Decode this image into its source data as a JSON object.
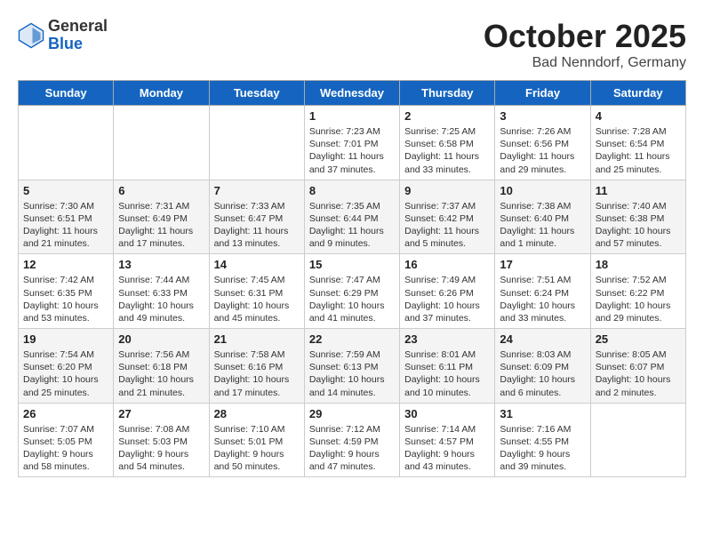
{
  "header": {
    "logo_general": "General",
    "logo_blue": "Blue",
    "month": "October 2025",
    "location": "Bad Nenndorf, Germany"
  },
  "days_of_week": [
    "Sunday",
    "Monday",
    "Tuesday",
    "Wednesday",
    "Thursday",
    "Friday",
    "Saturday"
  ],
  "weeks": [
    [
      {
        "day": "",
        "info": ""
      },
      {
        "day": "",
        "info": ""
      },
      {
        "day": "",
        "info": ""
      },
      {
        "day": "1",
        "info": "Sunrise: 7:23 AM\nSunset: 7:01 PM\nDaylight: 11 hours and 37 minutes."
      },
      {
        "day": "2",
        "info": "Sunrise: 7:25 AM\nSunset: 6:58 PM\nDaylight: 11 hours and 33 minutes."
      },
      {
        "day": "3",
        "info": "Sunrise: 7:26 AM\nSunset: 6:56 PM\nDaylight: 11 hours and 29 minutes."
      },
      {
        "day": "4",
        "info": "Sunrise: 7:28 AM\nSunset: 6:54 PM\nDaylight: 11 hours and 25 minutes."
      }
    ],
    [
      {
        "day": "5",
        "info": "Sunrise: 7:30 AM\nSunset: 6:51 PM\nDaylight: 11 hours and 21 minutes."
      },
      {
        "day": "6",
        "info": "Sunrise: 7:31 AM\nSunset: 6:49 PM\nDaylight: 11 hours and 17 minutes."
      },
      {
        "day": "7",
        "info": "Sunrise: 7:33 AM\nSunset: 6:47 PM\nDaylight: 11 hours and 13 minutes."
      },
      {
        "day": "8",
        "info": "Sunrise: 7:35 AM\nSunset: 6:44 PM\nDaylight: 11 hours and 9 minutes."
      },
      {
        "day": "9",
        "info": "Sunrise: 7:37 AM\nSunset: 6:42 PM\nDaylight: 11 hours and 5 minutes."
      },
      {
        "day": "10",
        "info": "Sunrise: 7:38 AM\nSunset: 6:40 PM\nDaylight: 11 hours and 1 minute."
      },
      {
        "day": "11",
        "info": "Sunrise: 7:40 AM\nSunset: 6:38 PM\nDaylight: 10 hours and 57 minutes."
      }
    ],
    [
      {
        "day": "12",
        "info": "Sunrise: 7:42 AM\nSunset: 6:35 PM\nDaylight: 10 hours and 53 minutes."
      },
      {
        "day": "13",
        "info": "Sunrise: 7:44 AM\nSunset: 6:33 PM\nDaylight: 10 hours and 49 minutes."
      },
      {
        "day": "14",
        "info": "Sunrise: 7:45 AM\nSunset: 6:31 PM\nDaylight: 10 hours and 45 minutes."
      },
      {
        "day": "15",
        "info": "Sunrise: 7:47 AM\nSunset: 6:29 PM\nDaylight: 10 hours and 41 minutes."
      },
      {
        "day": "16",
        "info": "Sunrise: 7:49 AM\nSunset: 6:26 PM\nDaylight: 10 hours and 37 minutes."
      },
      {
        "day": "17",
        "info": "Sunrise: 7:51 AM\nSunset: 6:24 PM\nDaylight: 10 hours and 33 minutes."
      },
      {
        "day": "18",
        "info": "Sunrise: 7:52 AM\nSunset: 6:22 PM\nDaylight: 10 hours and 29 minutes."
      }
    ],
    [
      {
        "day": "19",
        "info": "Sunrise: 7:54 AM\nSunset: 6:20 PM\nDaylight: 10 hours and 25 minutes."
      },
      {
        "day": "20",
        "info": "Sunrise: 7:56 AM\nSunset: 6:18 PM\nDaylight: 10 hours and 21 minutes."
      },
      {
        "day": "21",
        "info": "Sunrise: 7:58 AM\nSunset: 6:16 PM\nDaylight: 10 hours and 17 minutes."
      },
      {
        "day": "22",
        "info": "Sunrise: 7:59 AM\nSunset: 6:13 PM\nDaylight: 10 hours and 14 minutes."
      },
      {
        "day": "23",
        "info": "Sunrise: 8:01 AM\nSunset: 6:11 PM\nDaylight: 10 hours and 10 minutes."
      },
      {
        "day": "24",
        "info": "Sunrise: 8:03 AM\nSunset: 6:09 PM\nDaylight: 10 hours and 6 minutes."
      },
      {
        "day": "25",
        "info": "Sunrise: 8:05 AM\nSunset: 6:07 PM\nDaylight: 10 hours and 2 minutes."
      }
    ],
    [
      {
        "day": "26",
        "info": "Sunrise: 7:07 AM\nSunset: 5:05 PM\nDaylight: 9 hours and 58 minutes."
      },
      {
        "day": "27",
        "info": "Sunrise: 7:08 AM\nSunset: 5:03 PM\nDaylight: 9 hours and 54 minutes."
      },
      {
        "day": "28",
        "info": "Sunrise: 7:10 AM\nSunset: 5:01 PM\nDaylight: 9 hours and 50 minutes."
      },
      {
        "day": "29",
        "info": "Sunrise: 7:12 AM\nSunset: 4:59 PM\nDaylight: 9 hours and 47 minutes."
      },
      {
        "day": "30",
        "info": "Sunrise: 7:14 AM\nSunset: 4:57 PM\nDaylight: 9 hours and 43 minutes."
      },
      {
        "day": "31",
        "info": "Sunrise: 7:16 AM\nSunset: 4:55 PM\nDaylight: 9 hours and 39 minutes."
      },
      {
        "day": "",
        "info": ""
      }
    ]
  ]
}
